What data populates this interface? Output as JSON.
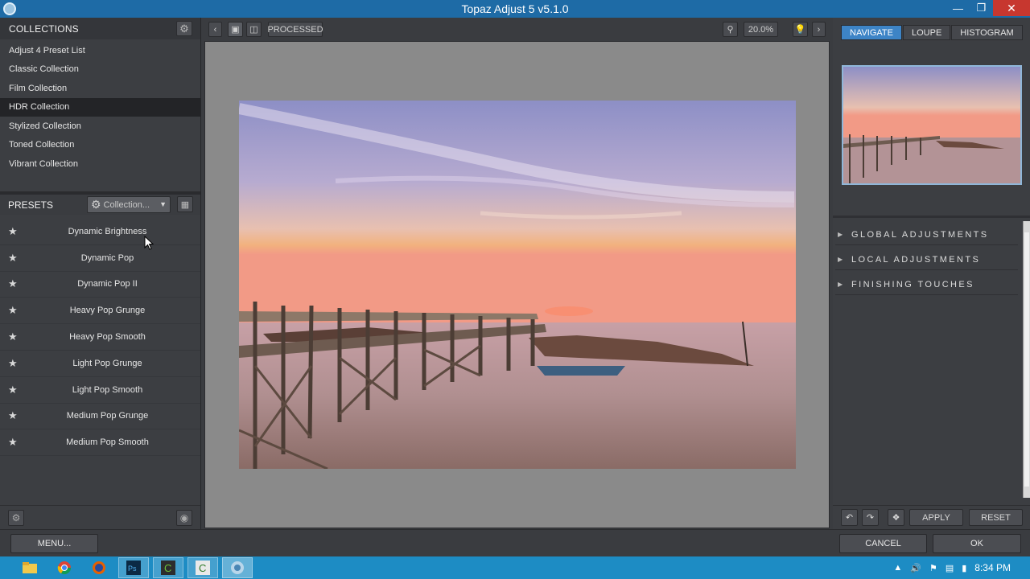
{
  "window": {
    "title": "Topaz Adjust 5 v5.1.0",
    "controls": [
      "minimize",
      "restore",
      "close"
    ]
  },
  "collections": {
    "header": "COLLECTIONS",
    "items": [
      {
        "label": "Adjust 4 Preset List",
        "active": false
      },
      {
        "label": "Classic Collection",
        "active": false
      },
      {
        "label": "Film Collection",
        "active": false
      },
      {
        "label": "HDR Collection",
        "active": true
      },
      {
        "label": "Stylized Collection",
        "active": false
      },
      {
        "label": "Toned Collection",
        "active": false
      },
      {
        "label": "Vibrant Collection",
        "active": false
      }
    ]
  },
  "presets": {
    "header": "PRESETS",
    "collection_dropdown": "Collection...",
    "items": [
      {
        "label": "Dynamic Brightness"
      },
      {
        "label": "Dynamic Pop"
      },
      {
        "label": "Dynamic Pop II"
      },
      {
        "label": "Heavy Pop Grunge"
      },
      {
        "label": "Heavy Pop Smooth"
      },
      {
        "label": "Light Pop Grunge"
      },
      {
        "label": "Light Pop Smooth"
      },
      {
        "label": "Medium Pop Grunge"
      },
      {
        "label": "Medium Pop Smooth"
      }
    ]
  },
  "toolbar": {
    "view_mode": "PROCESSED",
    "zoom": "20.0%"
  },
  "right_panel": {
    "tabs": [
      {
        "label": "NAVIGATE",
        "active": true
      },
      {
        "label": "LOUPE",
        "active": false
      },
      {
        "label": "HISTOGRAM",
        "active": false
      }
    ],
    "sections": [
      {
        "label": "GLOBAL ADJUSTMENTS"
      },
      {
        "label": "LOCAL ADJUSTMENTS"
      },
      {
        "label": "FINISHING TOUCHES"
      }
    ],
    "apply_label": "APPLY",
    "reset_label": "RESET"
  },
  "bottom": {
    "menu_label": "MENU...",
    "cancel_label": "CANCEL",
    "ok_label": "OK"
  },
  "taskbar": {
    "clock": "8:34 PM",
    "apps": [
      "file-explorer",
      "chrome",
      "firefox",
      "photoshop",
      "camtasia-recorder",
      "camtasia-studio",
      "topaz-adjust"
    ]
  },
  "colors": {
    "accent": "#3d84c6",
    "titlebar": "#1e6ba6",
    "taskbar": "#1d8cc4"
  }
}
